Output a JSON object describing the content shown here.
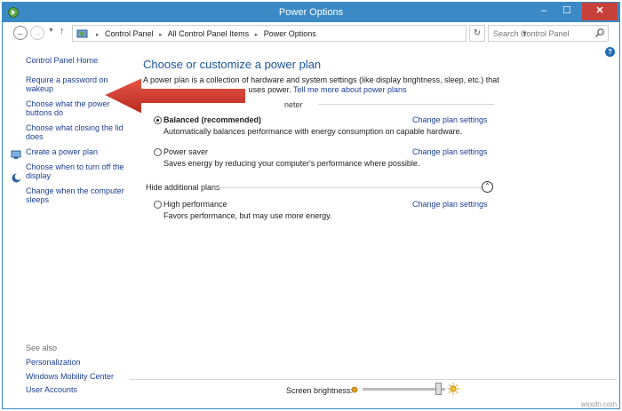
{
  "window": {
    "title": "Power Options",
    "controls": {
      "minimize": "–",
      "maximize": "☐",
      "close": "✕"
    }
  },
  "addressbar": {
    "crumbs": [
      "Control Panel",
      "All Control Panel Items",
      "Power Options"
    ],
    "search_placeholder": "Search Control Panel"
  },
  "sidebar": {
    "home": "Control Panel Home",
    "links": [
      {
        "label": "Require a password on wakeup",
        "icon": ""
      },
      {
        "label": "Choose what the power buttons do",
        "icon": ""
      },
      {
        "label": "Choose what closing the lid does",
        "icon": ""
      },
      {
        "label": "Create a power plan",
        "icon": ""
      },
      {
        "label": "Choose when to turn off the display",
        "icon": "monitor-shield-icon"
      },
      {
        "label": "Change when the computer sleeps",
        "icon": "moon-shield-icon"
      }
    ],
    "see_also": {
      "label": "See also",
      "links": [
        "Personalization",
        "Windows Mobility Center",
        "User Accounts"
      ]
    }
  },
  "main": {
    "heading": "Choose or customize a power plan",
    "intro": "A power plan is a collection of hardware and system settings (like display brightness, sleep, etc.) that manages how your computer uses power.",
    "intro_link": "Tell me more about power plans",
    "group_label": "neter",
    "plans": [
      {
        "name": "Balanced (recommended)",
        "selected": true,
        "description": "Automatically balances performance with energy consumption on capable hardware.",
        "action": "Change plan settings"
      },
      {
        "name": "Power saver",
        "selected": false,
        "description": "Saves energy by reducing your computer's performance where possible.",
        "action": "Change plan settings"
      },
      {
        "name": "High performance",
        "selected": false,
        "description": "Favors performance, but may use more energy.",
        "action": "Change plan settings"
      }
    ],
    "hide_label": "Hide additional plans"
  },
  "brightness": {
    "label": "Screen brightness:",
    "level": 0.9
  },
  "watermark": "wsxdn.com",
  "colors": {
    "titlebar": "#3b8ac5",
    "link": "#1c3f94",
    "heading": "#1c5599",
    "close_button": "#c7413a",
    "arrow": "#c8352a"
  }
}
